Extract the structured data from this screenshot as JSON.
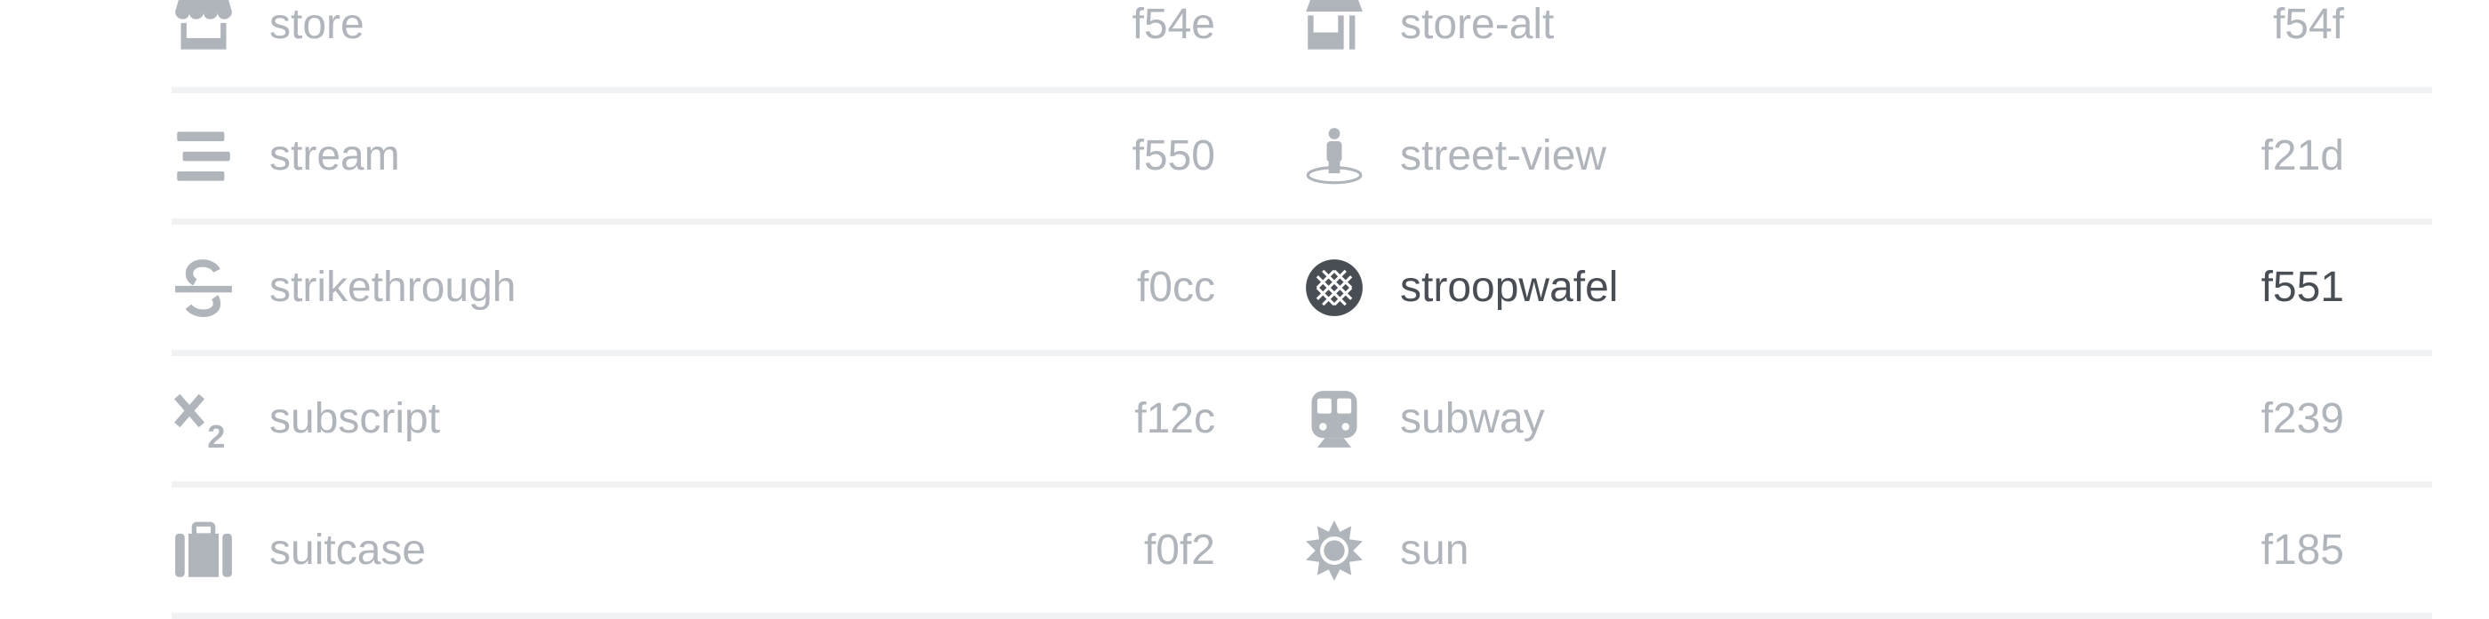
{
  "colors": {
    "muted": "#b0b5bc",
    "active": "#494e55",
    "divider": "#f1f2f4"
  },
  "rows": [
    {
      "left": {
        "icon": "store-icon",
        "name": "store",
        "code": "f54e"
      },
      "right": {
        "icon": "store-alt-icon",
        "name": "store-alt",
        "code": "f54f"
      }
    },
    {
      "left": {
        "icon": "stream-icon",
        "name": "stream",
        "code": "f550"
      },
      "right": {
        "icon": "street-view-icon",
        "name": "street-view",
        "code": "f21d"
      }
    },
    {
      "left": {
        "icon": "strikethrough-icon",
        "name": "strikethrough",
        "code": "f0cc"
      },
      "right": {
        "icon": "stroopwafel-icon",
        "name": "stroopwafel",
        "code": "f551",
        "active": true
      }
    },
    {
      "left": {
        "icon": "subscript-icon",
        "name": "subscript",
        "code": "f12c"
      },
      "right": {
        "icon": "subway-icon",
        "name": "subway",
        "code": "f239"
      }
    },
    {
      "left": {
        "icon": "suitcase-icon",
        "name": "suitcase",
        "code": "f0f2"
      },
      "right": {
        "icon": "sun-icon",
        "name": "sun",
        "code": "f185"
      }
    }
  ]
}
